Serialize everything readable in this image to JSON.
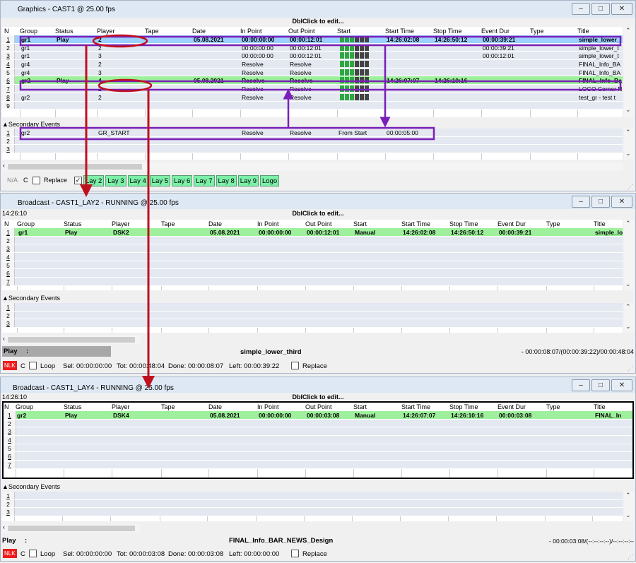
{
  "win1": {
    "title": "Graphics - CAST1 @ 25.00 fps",
    "dblclick": "DblClick to edit...",
    "headers": [
      "N",
      "Group",
      "Status",
      "Player",
      "Tape",
      "Date",
      "In Point",
      "Out Point",
      "Start",
      "Start Time",
      "Stop Time",
      "Event Dur",
      "Type",
      "Title"
    ],
    "rows": [
      {
        "n": "1",
        "group": "gr1",
        "status": "Play",
        "player": "2",
        "tape": "",
        "date": "05.08.2021",
        "in": "00:00:00:00",
        "out": "00:00:12:01",
        "start": "",
        "start_time": "14:26:02:08",
        "stop_time": "14:26:50:12",
        "dur": "00:00:39:21",
        "type": "",
        "title": "simple_lower_"
      },
      {
        "n": "2",
        "group": "gr1",
        "status": "",
        "player": "2",
        "tape": "",
        "date": "",
        "in": "00:00:00:00",
        "out": "00:00:12:01",
        "start": "",
        "start_time": "",
        "stop_time": "",
        "dur": "00:00:39:21",
        "type": "",
        "title": "simple_lower_t"
      },
      {
        "n": "3",
        "group": "gr1",
        "status": "",
        "player": "3",
        "tape": "",
        "date": "",
        "in": "00:00:00:00",
        "out": "00:00:12:01",
        "start": "",
        "start_time": "",
        "stop_time": "",
        "dur": "00:00:12:01",
        "type": "",
        "title": "simple_lower_t"
      },
      {
        "n": "4",
        "group": "gr4",
        "status": "",
        "player": "2",
        "tape": "",
        "date": "",
        "in": "Resolve",
        "out": "Resolve",
        "start": "",
        "start_time": "",
        "stop_time": "",
        "dur": "",
        "type": "",
        "title": "FINAL_Info_BA"
      },
      {
        "n": "5",
        "group": "gr4",
        "status": "",
        "player": "3",
        "tape": "",
        "date": "",
        "in": "Resolve",
        "out": "Resolve",
        "start": "",
        "start_time": "",
        "stop_time": "",
        "dur": "",
        "type": "",
        "title": "FINAL_Info_BA"
      },
      {
        "n": "6",
        "group": "gr2",
        "status": "Play",
        "player": "4",
        "tape": "",
        "date": "05.08.2021",
        "in": "Resolve",
        "out": "Resolve",
        "start": "",
        "start_time": "14:26:07:07",
        "stop_time": "14:26:10:16",
        "dur": "",
        "type": "",
        "title": "FINAL_Info_Ba"
      },
      {
        "n": "7",
        "group": "",
        "status": "",
        "player": "2",
        "tape": "",
        "date": "",
        "in": "Resolve",
        "out": "Resolve",
        "start": "",
        "start_time": "",
        "stop_time": "",
        "dur": "",
        "type": "",
        "title": "LOGO Corner N"
      },
      {
        "n": "8",
        "group": "gr2",
        "status": "",
        "player": "2",
        "tape": "",
        "date": "",
        "in": "Resolve",
        "out": "Resolve",
        "start": "",
        "start_time": "",
        "stop_time": "",
        "dur": "",
        "type": "",
        "title": "test_gr - test t"
      },
      {
        "n": "9",
        "group": "",
        "status": "",
        "player": "",
        "tape": "",
        "date": "",
        "in": "",
        "out": "",
        "start": "",
        "start_time": "",
        "stop_time": "",
        "dur": "",
        "type": "",
        "title": ""
      }
    ],
    "secondary_label": "Secondary Events",
    "sec_rows": [
      {
        "n": "1",
        "group": "gr2",
        "status": "",
        "player": "GR_START",
        "tape": "",
        "date": "",
        "in": "Resolve",
        "out": "Resolve",
        "start": "From Start",
        "start_time": "00:00:05:00",
        "stop_time": "",
        "dur": "",
        "type": "",
        "title": ""
      },
      {
        "n": "2",
        "group": "",
        "status": "",
        "player": "",
        "tape": "",
        "date": "",
        "in": "",
        "out": "",
        "start": "",
        "start_time": "",
        "stop_time": "",
        "dur": "",
        "type": "",
        "title": ""
      },
      {
        "n": "3",
        "group": "",
        "status": "",
        "player": "",
        "tape": "",
        "date": "",
        "in": "",
        "out": "",
        "start": "",
        "start_time": "",
        "stop_time": "",
        "dur": "",
        "type": "",
        "title": ""
      }
    ],
    "na": "N/A",
    "c": "C",
    "replace": "Replace",
    "layers": [
      "Lay 2",
      "Lay 3",
      "Lay 4",
      "Lay 5",
      "Lay 6",
      "Lay 7",
      "Lay 8",
      "Lay 9",
      "Logo"
    ]
  },
  "win2": {
    "title": "Broadcast - CAST1_LAY2 - RUNNING @ 25.00 fps",
    "clock": "14:26:10",
    "dblclick": "DblClick to edit...",
    "headers": [
      "N",
      "Group",
      "Status",
      "Player",
      "Tape",
      "Date",
      "In Point",
      "Out Point",
      "Start",
      "Start Time",
      "Stop Time",
      "Event Dur",
      "Type",
      "Title"
    ],
    "rows": [
      {
        "n": "1",
        "group": "gr1",
        "status": "Play",
        "player": "DSK2",
        "tape": "",
        "date": "05.08.2021",
        "in": "00:00:00:00",
        "out": "00:00:12:01",
        "start": "Manual",
        "start_time": "14:26:02:08",
        "stop_time": "14:26:50:12",
        "dur": "00:00:39:21",
        "type": "",
        "title": "simple_lo"
      },
      {
        "n": "2"
      },
      {
        "n": "3"
      },
      {
        "n": "4"
      },
      {
        "n": "5"
      },
      {
        "n": "6"
      },
      {
        "n": "7"
      }
    ],
    "secondary_label": "Secondary Events",
    "sec_rows": [
      {
        "n": "1"
      },
      {
        "n": "2"
      },
      {
        "n": "3"
      }
    ],
    "play_label": "Play",
    "play_colon": ":",
    "now_playing": "simple_lower_third",
    "remaining": "- 00:00:08:07/(00:00:39:22)/00:00:48:04",
    "nlk": "NLK",
    "c": "C",
    "loop": "Loop",
    "sel": "Sel: 00:00:00:00",
    "tot": "Tot: 00:00:48:04",
    "done": "Done: 00:00:08:07",
    "left": "Left: 00:00:39:22",
    "replace": "Replace"
  },
  "win3": {
    "title": "Broadcast - CAST1_LAY4 - RUNNING @ 25.00 fps",
    "clock": "14:26:10",
    "dblclick": "DblClick to edit...",
    "headers": [
      "N",
      "Group",
      "Status",
      "Player",
      "Tape",
      "Date",
      "In Point",
      "Out Point",
      "Start",
      "Start Time",
      "Stop Time",
      "Event Dur",
      "Type",
      "Title"
    ],
    "rows": [
      {
        "n": "1",
        "group": "gr2",
        "status": "Play",
        "player": "DSK4",
        "tape": "",
        "date": "05.08.2021",
        "in": "00:00:00:00",
        "out": "00:00:03:08",
        "start": "Manual",
        "start_time": "14:26:07:07",
        "stop_time": "14:26:10:16",
        "dur": "00:00:03:08",
        "type": "",
        "title": "FINAL_In"
      },
      {
        "n": "2"
      },
      {
        "n": "3"
      },
      {
        "n": "4"
      },
      {
        "n": "5"
      },
      {
        "n": "6"
      },
      {
        "n": "7"
      }
    ],
    "secondary_label": "Secondary Events",
    "sec_rows": [
      {
        "n": "1"
      },
      {
        "n": "2"
      },
      {
        "n": "3"
      }
    ],
    "play_label": "Play",
    "play_colon": ":",
    "now_playing": "FINAL_Info_BAR_NEWS_Design",
    "remaining": "- 00:00:03:08/(--:--:--:--)/--:--:--:--",
    "nlk": "NLK",
    "c": "C",
    "loop": "Loop",
    "sel": "Sel: 00:00:00:00",
    "tot": "Tot: 00:00:03:08",
    "done": "Done: 00:00:03:08",
    "left": "Left: 00:00:00:00",
    "replace": "Replace"
  },
  "colors": {
    "selected_row": "#9cd0ff",
    "playing_row": "#9ef09c",
    "annotation_red": "#c0101e",
    "annotation_purple": "#7a1fb8",
    "layer_button": "#7cf0a8",
    "nlk": "#ee1c1c"
  }
}
